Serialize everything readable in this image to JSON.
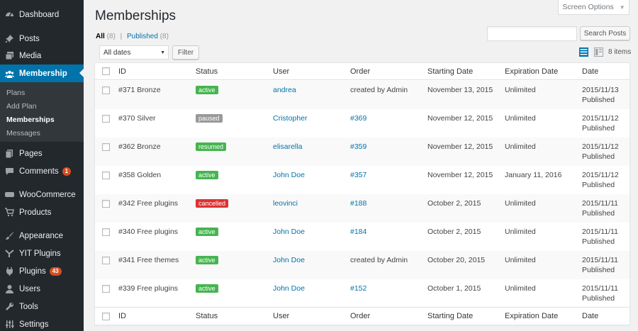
{
  "sidebar": {
    "items": [
      {
        "label": "Dashboard",
        "icon": "dashboard-icon"
      },
      {
        "label": "Posts",
        "icon": "pin-icon"
      },
      {
        "label": "Media",
        "icon": "media-icon"
      },
      {
        "label": "Membership",
        "icon": "group-icon"
      },
      {
        "label": "Pages",
        "icon": "pages-icon"
      },
      {
        "label": "Comments",
        "icon": "comment-icon",
        "badge": "1"
      },
      {
        "label": "WooCommerce",
        "icon": "woo-icon"
      },
      {
        "label": "Products",
        "icon": "cart-icon"
      },
      {
        "label": "Appearance",
        "icon": "brush-icon"
      },
      {
        "label": "YIT Plugins",
        "icon": "yit-icon"
      },
      {
        "label": "Plugins",
        "icon": "plugin-icon",
        "badge": "43"
      },
      {
        "label": "Users",
        "icon": "users-icon"
      },
      {
        "label": "Tools",
        "icon": "wrench-icon"
      },
      {
        "label": "Settings",
        "icon": "settings-icon"
      }
    ],
    "submenu": [
      "Plans",
      "Add Plan",
      "Memberships",
      "Messages"
    ]
  },
  "screen_options": "Screen Options",
  "page_title": "Memberships",
  "views": {
    "all": "All",
    "all_count": "(8)",
    "published": "Published",
    "published_count": "(8)",
    "sep": "|"
  },
  "search_button": "Search Posts",
  "date_filter": "All dates",
  "filter_button": "Filter",
  "items_count": "8 items",
  "columns": {
    "id": "ID",
    "status": "Status",
    "user": "User",
    "order": "Order",
    "start": "Starting Date",
    "exp": "Expiration Date",
    "date": "Date"
  },
  "colors": {
    "active": "#46b450",
    "paused": "#999999",
    "resumed": "#46b450",
    "cancelled": "#dc3232",
    "accent": "#0073aa"
  },
  "rows": [
    {
      "id": "#371 Bronze",
      "status": "active",
      "user": "andrea",
      "order": "created by Admin",
      "start": "November 13, 2015",
      "exp": "Unlimited",
      "date": "2015/11/13",
      "pub": "Published"
    },
    {
      "id": "#370 Silver",
      "status": "paused",
      "user": "Cristopher",
      "order": "#369",
      "start": "November 12, 2015",
      "exp": "Unlimited",
      "date": "2015/11/12",
      "pub": "Published"
    },
    {
      "id": "#362 Bronze",
      "status": "resumed",
      "user": "elisarella",
      "order": "#359",
      "start": "November 12, 2015",
      "exp": "Unlimited",
      "date": "2015/11/12",
      "pub": "Published"
    },
    {
      "id": "#358 Golden",
      "status": "active",
      "user": "John Doe",
      "order": "#357",
      "start": "November 12, 2015",
      "exp": "January 11, 2016",
      "date": "2015/11/12",
      "pub": "Published"
    },
    {
      "id": "#342 Free plugins",
      "status": "cancelled",
      "user": "leovinci",
      "order": "#188",
      "start": "October 2, 2015",
      "exp": "Unlimited",
      "date": "2015/11/11",
      "pub": "Published"
    },
    {
      "id": "#340 Free plugins",
      "status": "active",
      "user": "John Doe",
      "order": "#184",
      "start": "October 2, 2015",
      "exp": "Unlimited",
      "date": "2015/11/11",
      "pub": "Published"
    },
    {
      "id": "#341 Free themes",
      "status": "active",
      "user": "John Doe",
      "order": "created by Admin",
      "start": "October 20, 2015",
      "exp": "Unlimited",
      "date": "2015/11/11",
      "pub": "Published"
    },
    {
      "id": "#339 Free plugins",
      "status": "active",
      "user": "John Doe",
      "order": "#152",
      "start": "October 1, 2015",
      "exp": "Unlimited",
      "date": "2015/11/11",
      "pub": "Published"
    }
  ]
}
